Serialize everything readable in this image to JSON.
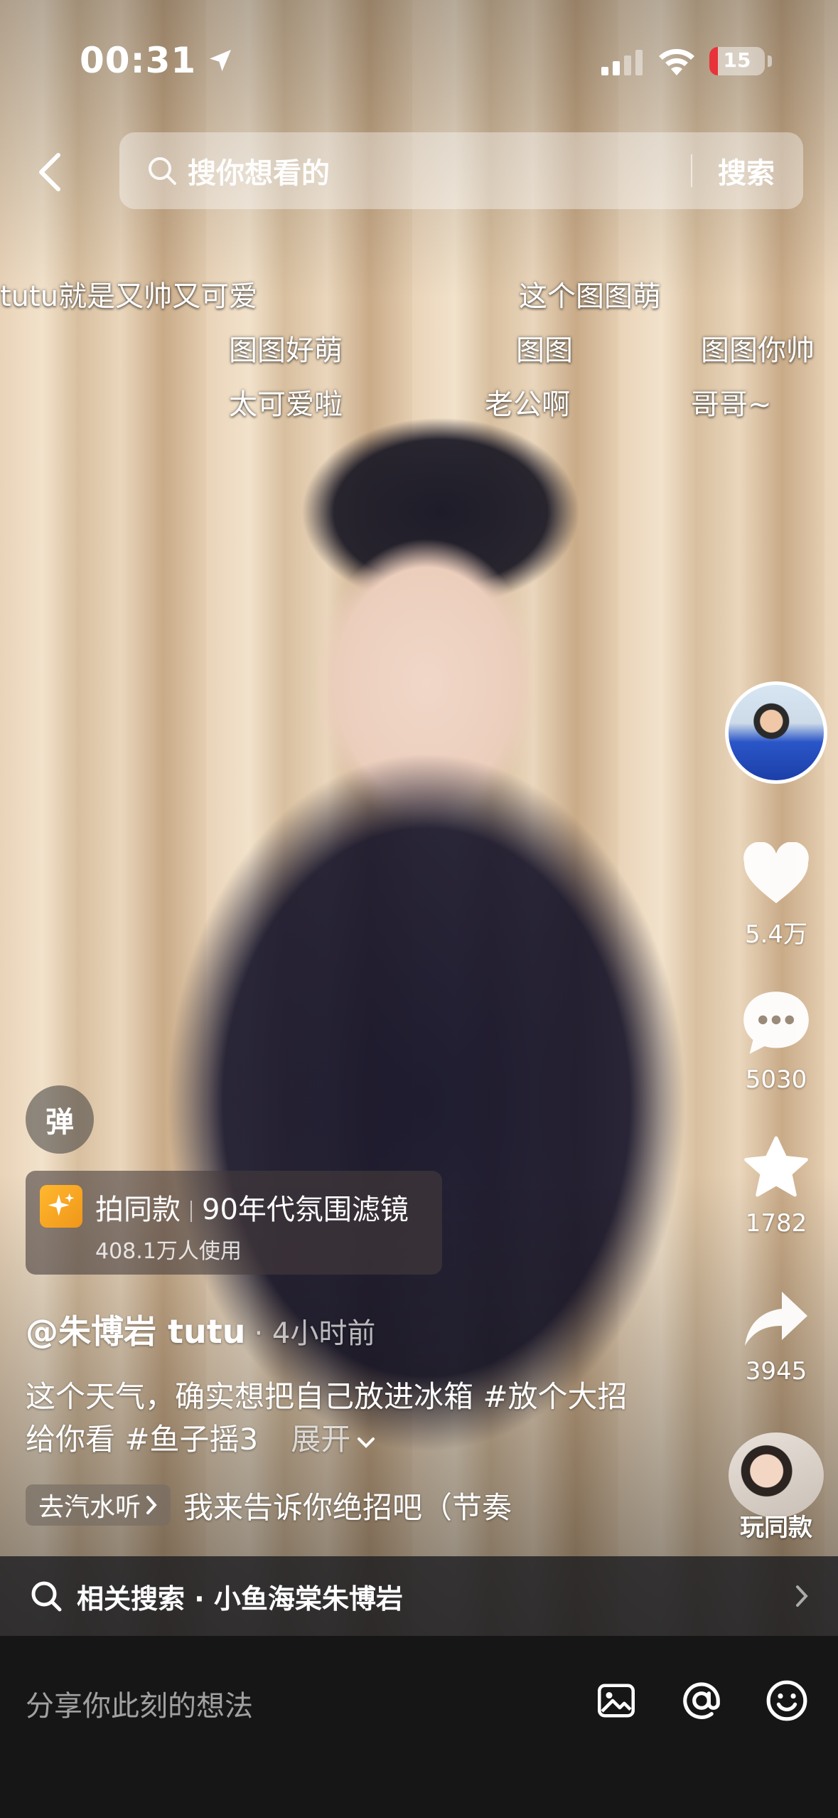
{
  "status_bar": {
    "time": "00:31",
    "battery": "15",
    "battery_level": 0.15
  },
  "search": {
    "placeholder": "搜你想看的",
    "button": "搜索"
  },
  "danmaku": [
    "tutu就是又帅又可爱",
    "这个图图萌",
    "图图好萌",
    "图图",
    "图图你帅",
    "太可爱啦",
    "老公啊",
    "哥哥~"
  ],
  "actions": {
    "like_count": "5.4万",
    "comment_count": "5030",
    "favorite_count": "1782",
    "share_count": "3945",
    "play_same_label": "玩同款"
  },
  "danmu_toggle": "弹",
  "effect": {
    "name": "拍同款",
    "filter": "90年代氛围滤镜",
    "users": "408.1万人使用"
  },
  "post": {
    "author": "@朱博岩 tutu",
    "ago": "· 4小时前",
    "caption": "这个天气，确实想把自己放进冰箱 #放个大招给你看 #鱼子摇3",
    "expand": "展开"
  },
  "music": {
    "chip": "去汽水听",
    "title": "我来告诉你绝招吧（节奏"
  },
  "related_search": "相关搜索 · 小鱼海棠朱博岩",
  "comment": {
    "placeholder": "分享你此刻的想法"
  },
  "colors": {
    "battery_low": "#e8333a",
    "effect_icon": "#ffb82e"
  }
}
